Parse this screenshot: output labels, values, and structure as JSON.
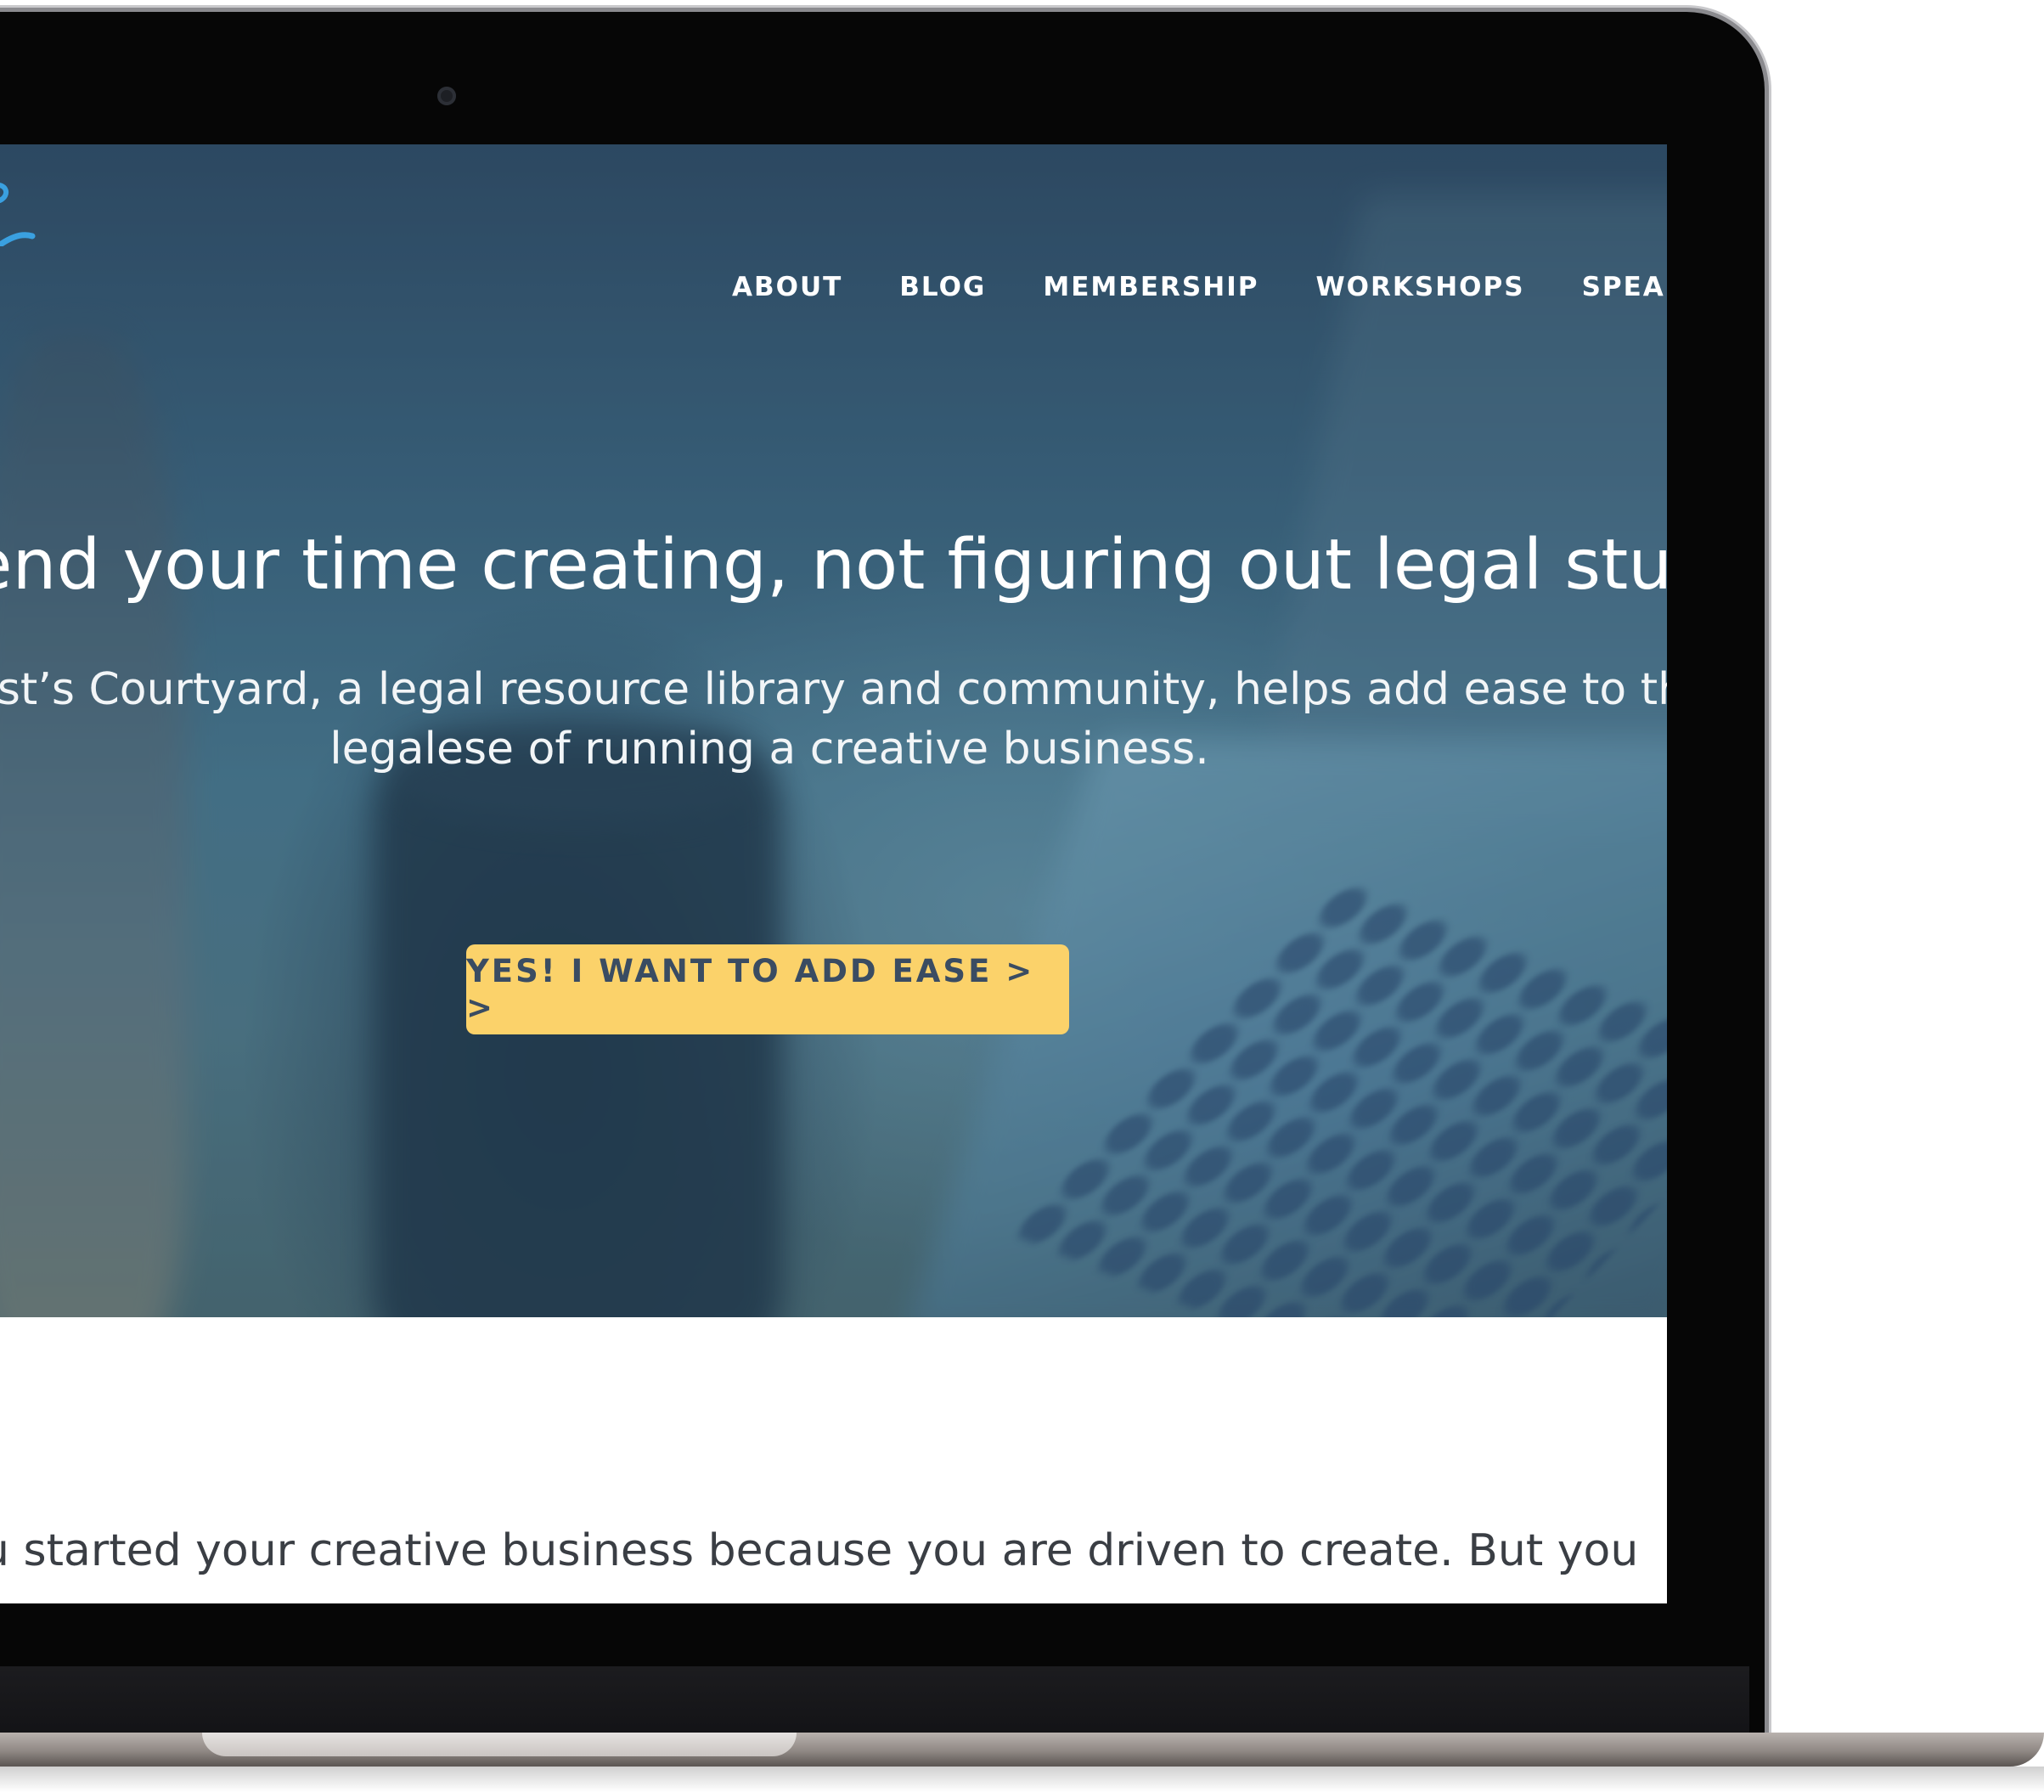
{
  "nav": {
    "items": [
      {
        "label": "ABOUT"
      },
      {
        "label": "BLOG"
      },
      {
        "label": "MEMBERSHIP"
      },
      {
        "label": "WORKSHOPS"
      },
      {
        "label": "SPEAKING"
      }
    ]
  },
  "hero": {
    "headline": "end your time creating, not figuring out legal stuff.",
    "subhead_line1": "tist’s Courtyard, a legal resource library and community, helps add ease to the",
    "subhead_line2": "legalese of running a creative business.",
    "cta_label": "YES! I WANT TO ADD EASE > >"
  },
  "content": {
    "intro_text": "u started your creative business because you are driven to create. But you"
  },
  "colors": {
    "cta_background": "#fbd26a",
    "cta_text": "#3a4c62",
    "logo_accent": "#3aa0e0",
    "hero_tint": "#3d6780"
  },
  "icons": {
    "logo": "brand-logo-mark",
    "camera": "webcam-dot"
  }
}
